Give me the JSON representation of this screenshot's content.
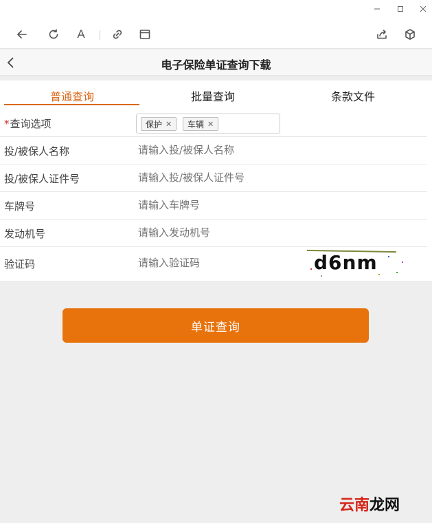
{
  "window": {
    "minimize_icon": "minimize-icon",
    "maximize_icon": "maximize-icon",
    "close_icon": "close-icon"
  },
  "toolbar": {
    "font_label": "A",
    "icons": [
      "back-arrow-icon",
      "refresh-icon",
      "font-icon",
      "link-icon",
      "window-icon",
      "share-icon",
      "cube-icon"
    ]
  },
  "header": {
    "title": "电子保险单证查询下载"
  },
  "tabs": [
    {
      "label": "普通查询",
      "active": true
    },
    {
      "label": "批量查询",
      "active": false
    },
    {
      "label": "条款文件",
      "active": false
    }
  ],
  "form": {
    "query_options": {
      "required_mark": "*",
      "label": "查询选项",
      "selected": [
        "保护",
        "车辆"
      ],
      "remove_glyph": "✕"
    },
    "insured_name": {
      "label": "投/被保人名称",
      "placeholder": "请输入投/被保人名称"
    },
    "insured_id": {
      "label": "投/被保人证件号",
      "placeholder": "请输入投/被保人证件号"
    },
    "plate": {
      "label": "车牌号",
      "placeholder": "请输入车牌号"
    },
    "engine": {
      "label": "发动机号",
      "placeholder": "请输入发动机号"
    },
    "captcha": {
      "label": "验证码",
      "placeholder": "请输入验证码",
      "code": "d6nm"
    }
  },
  "submit": {
    "label": "单证查询"
  },
  "watermark": {
    "part1": "云南",
    "part2": "龙网"
  },
  "colors": {
    "accent": "#e8720c",
    "tab_active": "#d9691a",
    "required": "#d9302f"
  }
}
